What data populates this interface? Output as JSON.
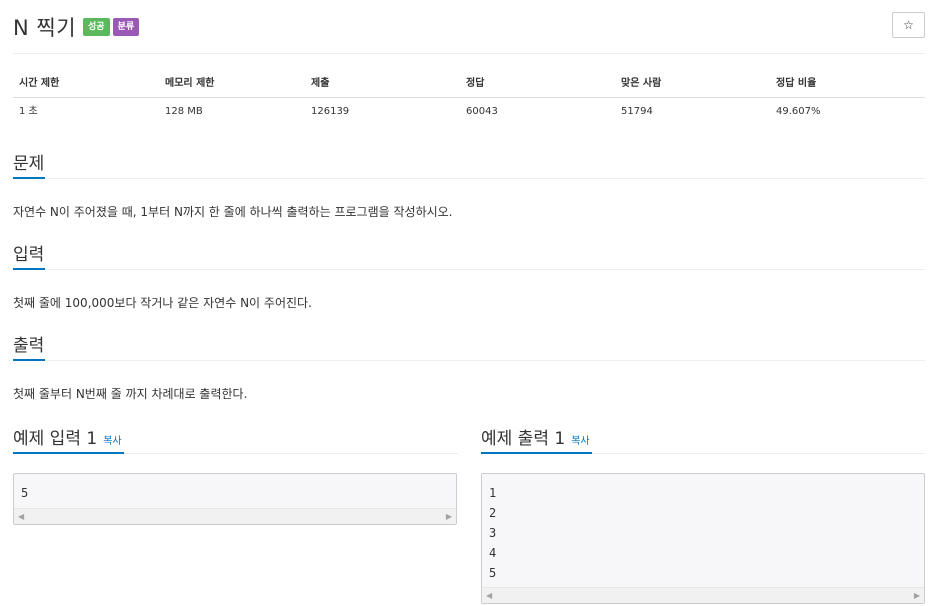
{
  "problem": {
    "title": "N 찍기",
    "badges": {
      "success": {
        "label": "성공",
        "color": "#5cb85c"
      },
      "classify": {
        "label": "분류",
        "color": "#9b59b6"
      }
    },
    "star_icon": "☆"
  },
  "info_table": {
    "headers": [
      "시간 제한",
      "메모리 제한",
      "제출",
      "정답",
      "맞은 사람",
      "정답 비율"
    ],
    "values": [
      "1 초",
      "128 MB",
      "126139",
      "60043",
      "51794",
      "49.607%"
    ]
  },
  "sections": {
    "description": {
      "title": "문제",
      "text": "자연수 N이 주어졌을 때, 1부터 N까지 한 줄에 하나씩 출력하는 프로그램을 작성하시오."
    },
    "input": {
      "title": "입력",
      "text": "첫째 줄에 100,000보다 작거나 같은 자연수 N이 주어진다."
    },
    "output": {
      "title": "출력",
      "text": "첫째 줄부터 N번째 줄 까지 차례대로 출력한다."
    }
  },
  "samples": {
    "input": {
      "title": "예제 입력 1",
      "copy_label": "복사",
      "content": "5"
    },
    "output": {
      "title": "예제 출력 1",
      "copy_label": "복사",
      "content": "1\n2\n3\n4\n5"
    }
  },
  "scroll_icons": {
    "left": "◀",
    "right": "▶"
  },
  "colors": {
    "accent": "#0076c0",
    "text": "#333333"
  }
}
